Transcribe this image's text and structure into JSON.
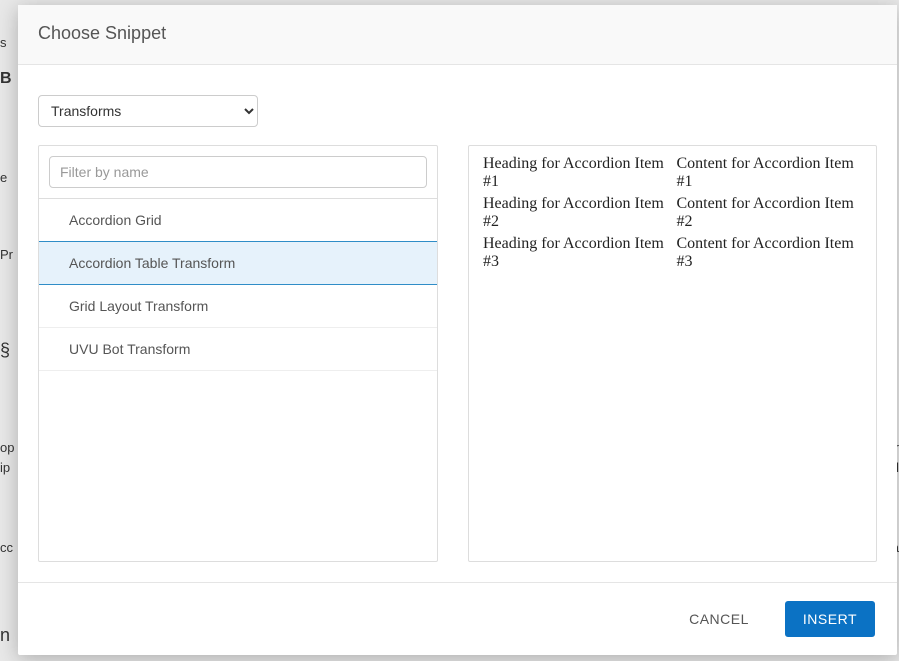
{
  "modal": {
    "title": "Choose Snippet"
  },
  "category": {
    "selected": "Transforms"
  },
  "filter": {
    "placeholder": "Filter by name",
    "value": ""
  },
  "snippets": [
    {
      "label": "Accordion Grid",
      "selected": false
    },
    {
      "label": "Accordion Table Transform",
      "selected": true
    },
    {
      "label": "Grid Layout Transform",
      "selected": false
    },
    {
      "label": "UVU Bot Transform",
      "selected": false
    }
  ],
  "preview": {
    "rows": [
      {
        "heading": "Heading for Accordion Item #1",
        "content": "Content for Accordion Item #1"
      },
      {
        "heading": "Heading for Accordion Item #2",
        "content": "Content for Accordion Item #2"
      },
      {
        "heading": "Heading for Accordion Item #3",
        "content": "Content for Accordion Item #3"
      }
    ]
  },
  "footer": {
    "cancel_label": "CANCEL",
    "insert_label": "INSERT"
  },
  "colors": {
    "primary": "#0b72c4",
    "selected_bg": "#e6f2fb",
    "selected_border": "#2f8dc7"
  }
}
